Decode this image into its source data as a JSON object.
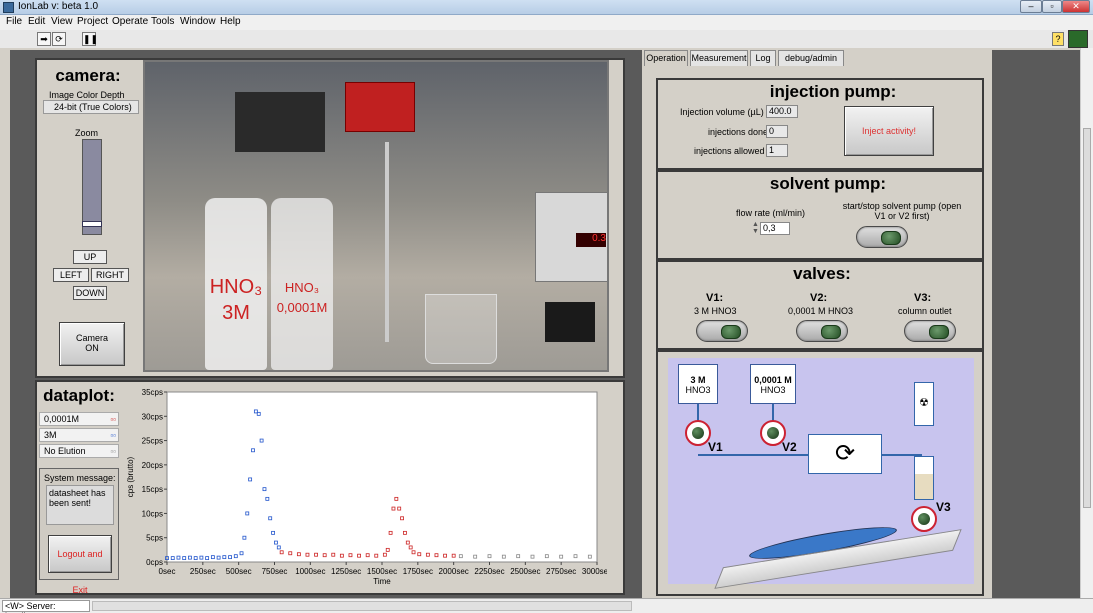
{
  "window": {
    "title": "IonLab v: beta 1.0"
  },
  "menu": [
    "File",
    "Edit",
    "View",
    "Project",
    "Operate",
    "Tools",
    "Window",
    "Help"
  ],
  "toolbar": {
    "run": "➡",
    "runcont": "⟳",
    "pause": "❚❚",
    "help": "?"
  },
  "camera": {
    "heading": "camera:",
    "depth_label": "Image Color Depth",
    "depth_value": "24-bit (True Colors)",
    "zoom_label": "Zoom",
    "up": "UP",
    "left": "LEFT",
    "right": "RIGHT",
    "down": "DOWN",
    "camera_button": "Camera ON",
    "bottle1": "HNO₃ 3M",
    "bottle2": "HNO₃ 0,0001M",
    "zoom_level": 0.1
  },
  "dataplot": {
    "heading": "dataplot:",
    "legend": [
      "0,0001M",
      "3M",
      "No Elution"
    ]
  },
  "system": {
    "label": "System message:",
    "message": "datasheet has been sent!",
    "logout": "Logout and Exit"
  },
  "tabs": [
    "Operation",
    "Measurement",
    "Log",
    "debug/admin"
  ],
  "injection": {
    "heading": "injection pump:",
    "volume_label": "Injection volume (µL)",
    "volume": "400.0",
    "done_label": "injections done",
    "done": "0",
    "allowed_label": "injections allowed",
    "allowed": "1",
    "button": "Inject activity!"
  },
  "solvent": {
    "heading": "solvent pump:",
    "flow_label": "flow rate (ml/min)",
    "flow": "0,3",
    "toggle_label": "start/stop solvent pump (open V1 or V2 first)"
  },
  "valves": {
    "heading": "valves:",
    "v1": "V1:",
    "v1_sub": "3 M HNO3",
    "v2": "V2:",
    "v2_sub": "0,0001 M HNO3",
    "v3": "V3:",
    "v3_sub": "column outlet"
  },
  "diagram": {
    "box1_top": "3 M",
    "box1_bot": "HNO3",
    "box2_top": "0,0001 M",
    "box2_bot": "HNO3",
    "v1": "V1",
    "v2": "V2",
    "v3": "V3"
  },
  "status": {
    "server": "<W> Server: localhost"
  },
  "colors": {
    "blue": "#2255cc",
    "red": "#cc2222",
    "gray": "#888888",
    "diagram_bg": "#c8c4ee"
  },
  "chart_data": {
    "type": "scatter",
    "xlabel": "Time",
    "ylabel": "cps (brutto)",
    "xlim": [
      0,
      3000
    ],
    "ylim": [
      0,
      35
    ],
    "xticks": [
      "0sec",
      "250sec",
      "500sec",
      "750sec",
      "1000sec",
      "1250sec",
      "1500sec",
      "1750sec",
      "2000sec",
      "2250sec",
      "2500sec",
      "2750sec",
      "3000sec"
    ],
    "yticks": [
      "0cps",
      "5cps",
      "10cps",
      "15cps",
      "20cps",
      "25cps",
      "30cps",
      "35cps"
    ],
    "series": [
      {
        "name": "3M",
        "color": "#2255cc",
        "x": [
          0,
          40,
          80,
          120,
          160,
          200,
          240,
          280,
          320,
          360,
          400,
          440,
          480,
          520,
          540,
          560,
          580,
          600,
          620,
          640,
          660,
          680,
          700,
          720,
          740,
          760,
          780
        ],
        "y": [
          0.8,
          0.8,
          0.9,
          0.8,
          0.9,
          0.8,
          0.9,
          0.8,
          1,
          0.9,
          1,
          1,
          1.2,
          1.8,
          5,
          10,
          17,
          23,
          31,
          30.5,
          25,
          15,
          13,
          9,
          6,
          4,
          3
        ]
      },
      {
        "name": "0,0001M",
        "color": "#cc2222",
        "x": [
          800,
          860,
          920,
          980,
          1040,
          1100,
          1160,
          1220,
          1280,
          1340,
          1400,
          1460,
          1520,
          1540,
          1560,
          1580,
          1600,
          1620,
          1640,
          1660,
          1680,
          1700,
          1720,
          1760,
          1820,
          1880,
          1940,
          2000
        ],
        "y": [
          2,
          1.8,
          1.6,
          1.5,
          1.5,
          1.4,
          1.5,
          1.3,
          1.4,
          1.3,
          1.4,
          1.3,
          1.5,
          2.5,
          6,
          11,
          13,
          11,
          9,
          6,
          4,
          3,
          2,
          1.6,
          1.5,
          1.4,
          1.3,
          1.3
        ]
      },
      {
        "name": "No Elution",
        "color": "#888888",
        "x": [
          2050,
          2150,
          2250,
          2350,
          2450,
          2550,
          2650,
          2750,
          2850,
          2950
        ],
        "y": [
          1.2,
          1.1,
          1.2,
          1.1,
          1.2,
          1.1,
          1.2,
          1.1,
          1.2,
          1.1
        ]
      }
    ]
  }
}
